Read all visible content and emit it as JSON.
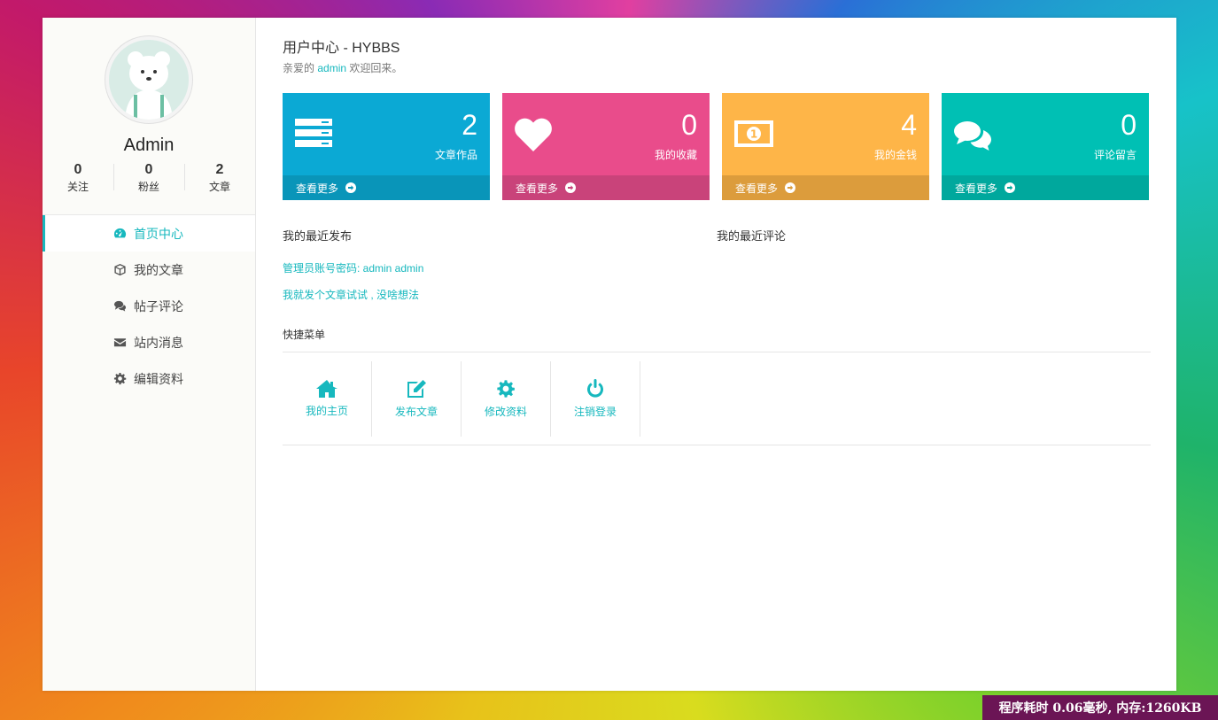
{
  "header": {
    "title": "用户中心 - HYBBS",
    "welcome_prefix": "亲爱的",
    "welcome_name": "admin",
    "welcome_suffix": "欢迎回来。"
  },
  "profile": {
    "username": "Admin",
    "stats": [
      {
        "num": "0",
        "label": "关注"
      },
      {
        "num": "0",
        "label": "粉丝"
      },
      {
        "num": "2",
        "label": "文章"
      }
    ]
  },
  "sidebar": {
    "items": [
      {
        "label": "首页中心",
        "icon": "dashboard-icon"
      },
      {
        "label": "我的文章",
        "icon": "cube-icon"
      },
      {
        "label": "帖子评论",
        "icon": "comments-icon"
      },
      {
        "label": "站内消息",
        "icon": "envelope-icon"
      },
      {
        "label": "编辑资料",
        "icon": "gear-icon"
      }
    ]
  },
  "cards": [
    {
      "num": "2",
      "label": "文章作品",
      "more": "查看更多",
      "color": "#0ba9d4",
      "icon": "server-icon"
    },
    {
      "num": "0",
      "label": "我的收藏",
      "more": "查看更多",
      "color": "#e94c8b",
      "icon": "heart-icon"
    },
    {
      "num": "4",
      "label": "我的金钱",
      "more": "查看更多",
      "color": "#feb548",
      "icon": "money-icon"
    },
    {
      "num": "0",
      "label": "评论留言",
      "more": "查看更多",
      "color": "#00c0b4",
      "icon": "comments-icon"
    }
  ],
  "recent_posts": {
    "title": "我的最近发布",
    "items": [
      "管理员账号密码: admin admin",
      "我就发个文章试试 , 没啥想法"
    ]
  },
  "recent_comments": {
    "title": "我的最近评论"
  },
  "quick_menu": {
    "title": "快捷菜单",
    "items": [
      {
        "label": "我的主页",
        "icon": "home-icon"
      },
      {
        "label": "发布文章",
        "icon": "edit-icon"
      },
      {
        "label": "修改资料",
        "icon": "gear-icon"
      },
      {
        "label": "注销登录",
        "icon": "power-icon"
      }
    ]
  },
  "footer": {
    "perf": "程序耗时 0.06毫秒, 内存:1260KB"
  }
}
